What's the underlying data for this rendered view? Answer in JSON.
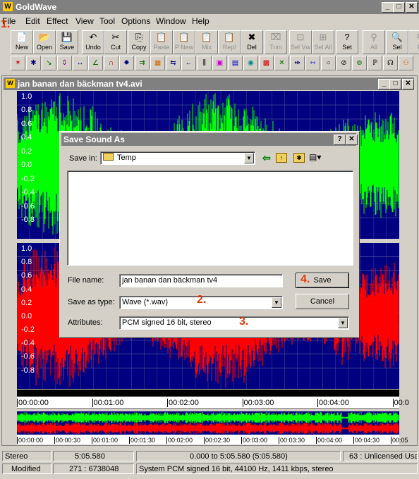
{
  "app": {
    "title": "GoldWave"
  },
  "menu": [
    "File",
    "Edit",
    "Effect",
    "View",
    "Tool",
    "Options",
    "Window",
    "Help"
  ],
  "toolbar": [
    {
      "label": "New",
      "icon": "📄",
      "disabled": false
    },
    {
      "label": "Open",
      "icon": "📂",
      "disabled": false
    },
    {
      "label": "Save",
      "icon": "💾",
      "disabled": false
    },
    {
      "label": "Undo",
      "icon": "↶",
      "disabled": false
    },
    {
      "label": "Cut",
      "icon": "✂",
      "disabled": false
    },
    {
      "label": "Copy",
      "icon": "⎘",
      "disabled": false
    },
    {
      "label": "Paste",
      "icon": "📋",
      "disabled": true
    },
    {
      "label": "P New",
      "icon": "📋",
      "disabled": true
    },
    {
      "label": "Mix",
      "icon": "📋",
      "disabled": true
    },
    {
      "label": "Repl",
      "icon": "📋",
      "disabled": true
    },
    {
      "label": "Del",
      "icon": "✖",
      "disabled": false
    },
    {
      "label": "Trim",
      "icon": "⌧",
      "disabled": true
    },
    {
      "label": "Sel Vw",
      "icon": "⊡",
      "disabled": true
    },
    {
      "label": "Sel All",
      "icon": "⊞",
      "disabled": true
    },
    {
      "label": "Set",
      "icon": "?",
      "disabled": false
    },
    {
      "label": "All",
      "icon": "⚲",
      "disabled": true
    },
    {
      "label": "Sel",
      "icon": "🔍",
      "disabled": false
    },
    {
      "label": "P",
      "icon": "⚲",
      "disabled": true
    }
  ],
  "effects_toolbar": [
    "✶",
    "✱",
    "↘",
    "⇕",
    "↔",
    "∠",
    "∩",
    "✹",
    "⇉",
    "▦",
    "⇆",
    "←",
    "⫼",
    "▣",
    "▤",
    "◉",
    "▩",
    "✕",
    "⇹",
    "⇿",
    "○",
    "⊘",
    "⊚",
    "ℙ",
    "☊",
    "⚇"
  ],
  "document": {
    "title": "jan banan dan bäckman tv4.avi"
  },
  "channels": {
    "left": {
      "color": "#00ff00",
      "labels": [
        "1.0",
        "0.8",
        "0.6",
        "0.4",
        "0.2",
        "0.0",
        "-0.2",
        "-0.4",
        "-0.6",
        "-0.8"
      ]
    },
    "right": {
      "color": "#ff0000",
      "labels": [
        "1.0",
        "0.8",
        "0.6",
        "0.4",
        "0.2",
        "0.0",
        "-0.2",
        "-0.4",
        "-0.6",
        "-0.8"
      ]
    }
  },
  "timeline": [
    "00:00:00",
    "00:01:00",
    "00:02:00",
    "00:03:00",
    "00:04:00",
    "00:0"
  ],
  "overview_timeline": [
    "00:00:00",
    "00:00:30",
    "00:01:00",
    "00:01:30",
    "00:02:00",
    "00:02:30",
    "00:03:00",
    "00:03:30",
    "00:04:00",
    "00:04:30",
    "00:05"
  ],
  "dialog": {
    "title": "Save Sound As",
    "help": "?",
    "close": "✕",
    "save_in_label": "Save in:",
    "save_in_value": "Temp",
    "file_name_label": "File name:",
    "file_name_value": "jan banan dan bäckman tv4",
    "save_as_type_label": "Save as type:",
    "save_as_type_value": "Wave (*.wav)",
    "attributes_label": "Attributes:",
    "attributes_value": "PCM signed 16 bit, stereo",
    "save_button": "Save",
    "cancel_button": "Cancel"
  },
  "annotations": {
    "a1": "1.",
    "a2": "2.",
    "a3": "3.",
    "a4": "4."
  },
  "status": {
    "channels": "Stereo",
    "length": "5:05.580",
    "selection": "0.000 to 5:05.580 (5:05.580)",
    "license": "63 : Unlicensed Usa",
    "modified": "Modified",
    "position": "271 : 6738048",
    "format": "System PCM signed 16 bit, 44100 Hz, 1411 kbps, stereo"
  }
}
